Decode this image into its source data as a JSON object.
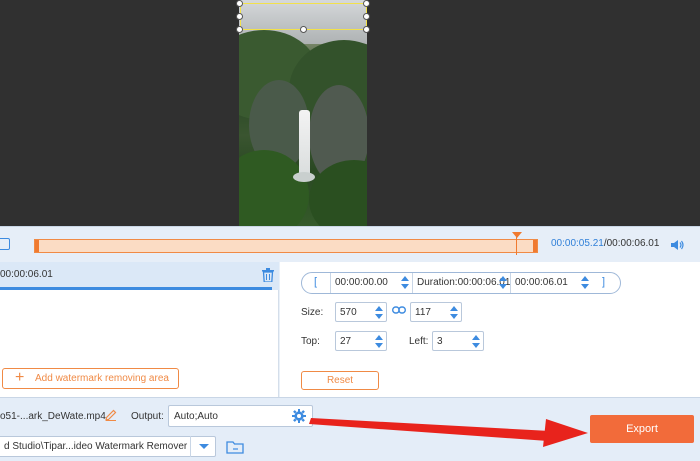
{
  "timeline": {
    "current_time": "00:00:05.21",
    "total_time": "/00:00:06.01"
  },
  "segment": {
    "time": "00:00:06.01"
  },
  "add_area": {
    "label": "Add watermark removing area"
  },
  "trim": {
    "open_bracket": "[",
    "start": "00:00:00.00",
    "duration": "Duration:00:00:06.01",
    "end": "00:00:06.01",
    "close_bracket": "]"
  },
  "size": {
    "label": "Size:",
    "width": "570",
    "height": "117"
  },
  "position": {
    "top_label": "Top:",
    "top_value": "27",
    "left_label": "Left:",
    "left_value": "3"
  },
  "reset_label": "Reset",
  "bottom": {
    "file_name": "o51-...ark_DeWate.mp4",
    "output_label": "Output:",
    "output_value": "Auto;Auto",
    "save_path": "d Studio\\Tipar...ideo Watermark Remover",
    "export_label": "Export"
  },
  "colors": {
    "accent_blue": "#3d8be0",
    "accent_orange": "#f08a45",
    "export": "#f26b3a",
    "arrow": "#e8231c"
  }
}
